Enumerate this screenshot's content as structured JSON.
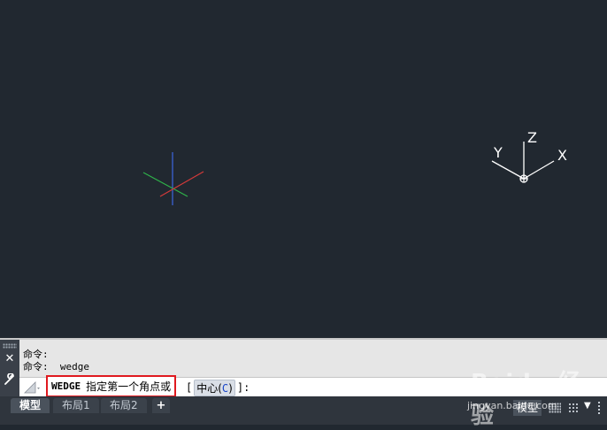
{
  "viewport": {
    "ucs_labels": {
      "x": "X",
      "y": "Y",
      "z": "Z"
    },
    "colors": {
      "background": "#212830",
      "x_axis": "#d23a3a",
      "y_axis": "#2fb34a",
      "z_axis": "#3c66e0",
      "ucs": "#ffffff"
    }
  },
  "command_window": {
    "history": [
      "命令:",
      "命令:  wedge"
    ],
    "current_command": "WEDGE",
    "prompt": "指定第一个角点或",
    "options_open": "[",
    "option_label": "中心(",
    "option_key": "C",
    "option_close": ")",
    "options_end": "]:",
    "close_icon": "close-icon",
    "customize_icon": "wrench-icon",
    "highlight_color": "#e0191f"
  },
  "layout_tabs": [
    {
      "label": "模型",
      "active": true
    },
    {
      "label": "布局1",
      "active": false
    },
    {
      "label": "布局2",
      "active": false
    }
  ],
  "add_tab_label": "+",
  "status_bar": {
    "space_label": "模型",
    "more_icon": "caret-down-icon"
  },
  "watermark": {
    "logo_text": "Baidu 经验",
    "url": "jingyan.baidu.com"
  }
}
